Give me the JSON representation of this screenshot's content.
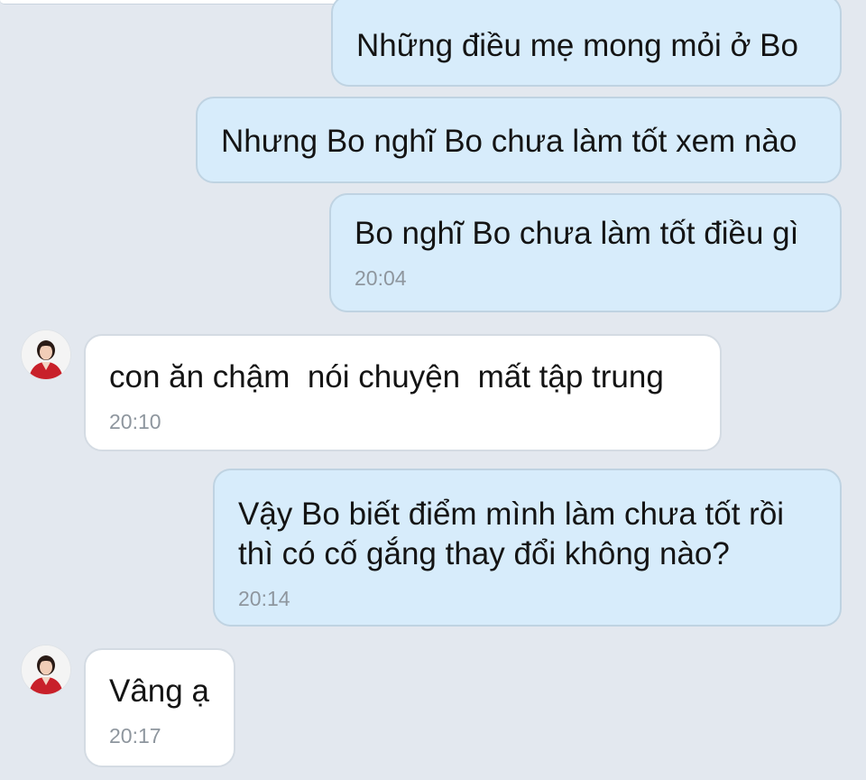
{
  "messages": [
    {
      "text": "Những điều mẹ mong mỏi ở Bo",
      "time": ""
    },
    {
      "text": "Nhưng Bo nghĩ Bo chưa làm tốt xem nào",
      "time": ""
    },
    {
      "text": "Bo nghĩ Bo chưa làm tốt điều gì",
      "time": "20:04"
    },
    {
      "text": "con ăn chậm  nói chuyện  mất tập trung",
      "time": "20:10"
    },
    {
      "text": "Vậy Bo biết điểm mình làm chưa tốt rồi\nthì có cố gắng thay đổi không nào?",
      "time": "20:14"
    },
    {
      "text": "Vâng ạ",
      "time": "20:17"
    }
  ],
  "colors": {
    "background": "#e3e8ef",
    "outgoing_bubble": "#d7ecfb",
    "incoming_bubble": "#ffffff",
    "timestamp": "#8e969e"
  }
}
